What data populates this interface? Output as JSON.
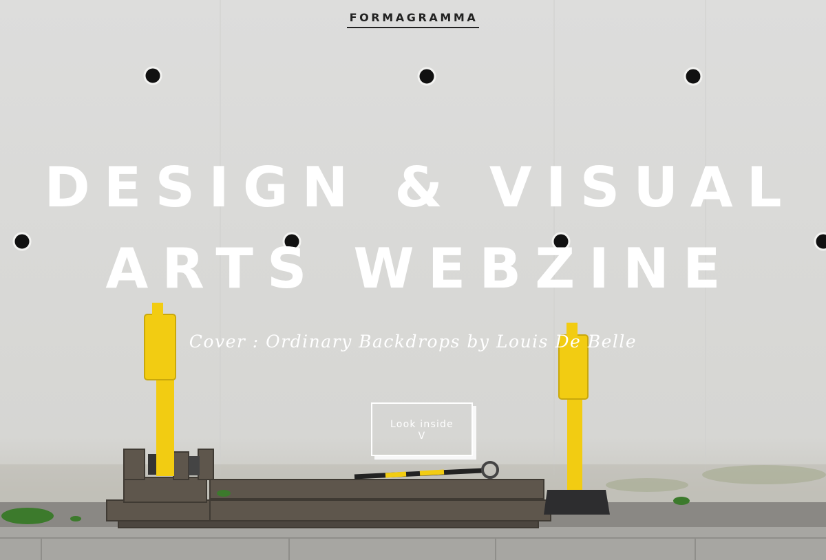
{
  "site": {
    "brand": "FORMAGRAMMA"
  },
  "hero": {
    "headline_line1": "DESIGN & VISUAL",
    "headline_line2": "ARTS WEBZINE",
    "subtitle": "Cover : Ordinary Backdrops by Louis De Belle",
    "cta_label": "Look inside",
    "cta_arrow": "V"
  },
  "colors": {
    "wall": "#dcdcda",
    "text": "#ffffff",
    "brand_text": "#222222",
    "bollard": "#f2cc12"
  },
  "icons": {
    "cta_arrow": "chevron-down-icon"
  }
}
